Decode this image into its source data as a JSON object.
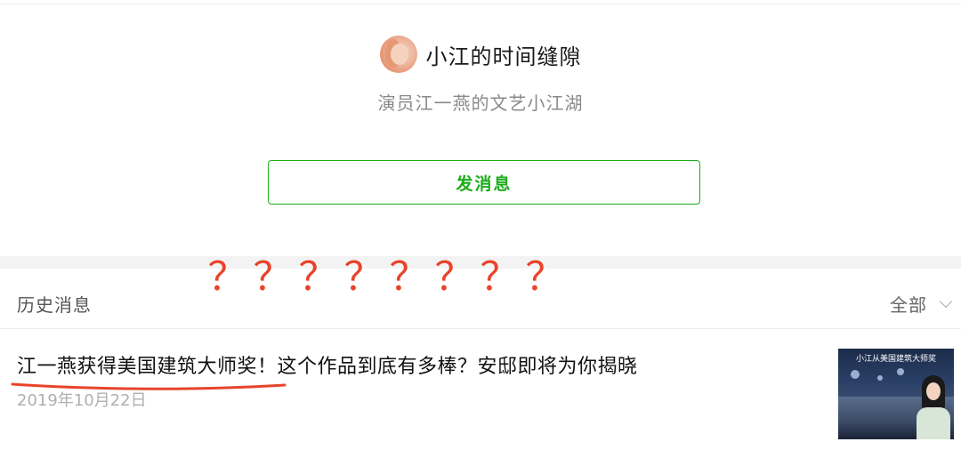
{
  "profile": {
    "account_name": "小江的时间缝隙",
    "bio": "演员江一燕的文艺小江湖",
    "message_button_label": "发消息"
  },
  "annotation": {
    "question_marks": [
      "？",
      "？",
      "？",
      "？",
      "？",
      "？",
      "？",
      "？"
    ],
    "color": "#e8442b"
  },
  "history": {
    "title": "历史消息",
    "filter_label": "全部"
  },
  "articles": [
    {
      "title": "江一燕获得美国建筑大师奖！这个作品到底有多棒？安邸即将为你揭晓",
      "date": "2019年10月22日",
      "thumbnail_caption": "小江从美国建筑大师奖"
    }
  ],
  "colors": {
    "accent_green": "#1aad19",
    "annotation_red": "#e8442b"
  }
}
